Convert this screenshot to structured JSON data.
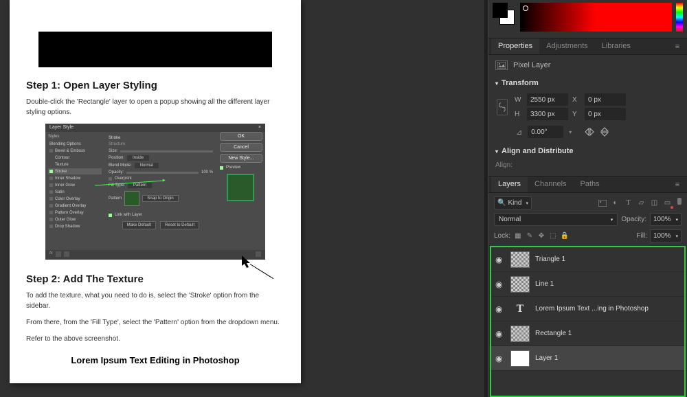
{
  "document": {
    "step1_title": "Step 1: Open Layer Styling",
    "step1_body": "Double-click the 'Rectangle' layer to open a popup showing all the different layer styling options.",
    "step2_title": "Step 2: Add The Texture",
    "step2_body1": "To add the texture, what you need to do is, select the 'Stroke' option from the sidebar.",
    "step2_body2": "From there, from the 'Fill Type', select the 'Pattern' option from the dropdown menu.",
    "step2_body3": "Refer to the above screenshot.",
    "footer_title": "Lorem Ipsum Text Editing in Photoshop",
    "dialog": {
      "title": "Layer Style",
      "sidebar_header": "Styles",
      "sidebar_sub": "Blending Options",
      "items": [
        "Bevel & Emboss",
        "Contour",
        "Texture",
        "Stroke",
        "Inner Shadow",
        "Inner Glow",
        "Satin",
        "Color Overlay",
        "Gradient Overlay",
        "Pattern Overlay",
        "Outer Glow",
        "Drop Shadow"
      ],
      "center": {
        "header": "Stroke",
        "sub": "Structure",
        "size": "Size:",
        "position": "Position:",
        "blend": "Blend Mode:",
        "opacity": "Opacity:",
        "overprint": "Overprint",
        "filltype": "Fill Type:",
        "pattern": "Pattern",
        "snap": "Snap to Origin",
        "scale": "Link with Layer",
        "make_default": "Make Default",
        "reset_default": "Reset to Default"
      },
      "buttons": {
        "ok": "OK",
        "cancel": "Cancel",
        "new_style": "New Style...",
        "preview": "Preview"
      }
    }
  },
  "properties": {
    "tabs": [
      "Properties",
      "Adjustments",
      "Libraries"
    ],
    "layer_type": "Pixel Layer",
    "transform_label": "Transform",
    "w_label": "W",
    "w_value": "2550 px",
    "h_label": "H",
    "h_value": "3300 px",
    "x_label": "X",
    "x_value": "0 px",
    "y_label": "Y",
    "y_value": "0 px",
    "rotate_value": "0.00°",
    "align_label": "Align and Distribute",
    "align_sub": "Align:"
  },
  "layers_panel": {
    "tabs": [
      "Layers",
      "Channels",
      "Paths"
    ],
    "kind_label": "Kind",
    "blend_mode": "Normal",
    "opacity_label": "Opacity:",
    "opacity_value": "100%",
    "lock_label": "Lock:",
    "fill_label": "Fill:",
    "fill_value": "100%",
    "layers": [
      {
        "name": "Triangle 1",
        "thumb": "checker"
      },
      {
        "name": "Line 1",
        "thumb": "checker"
      },
      {
        "name": "Lorem Ipsum Text ...ing in Photoshop",
        "thumb": "T"
      },
      {
        "name": "Rectangle 1",
        "thumb": "checker"
      },
      {
        "name": "Layer 1",
        "thumb": "white",
        "selected": true
      }
    ]
  },
  "icons": {
    "search": "🔍"
  }
}
